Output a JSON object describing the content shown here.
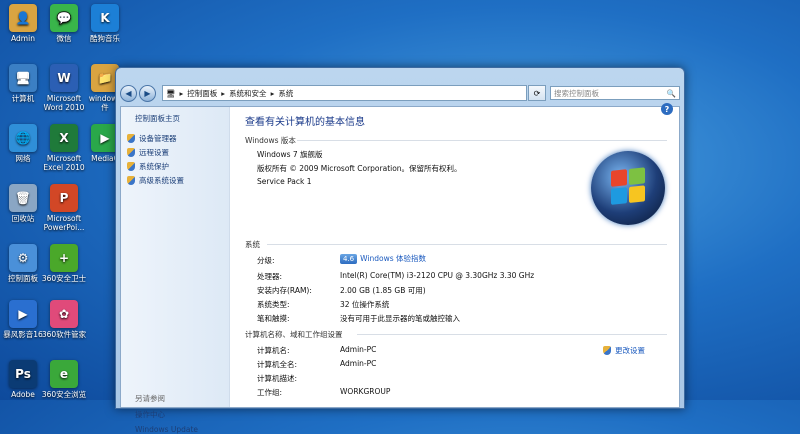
{
  "desktop": {
    "icons": [
      {
        "label": "Admin",
        "glyph": "👤",
        "color": "#d9a441"
      },
      {
        "label": "微信",
        "glyph": "💬",
        "color": "#39b54a"
      },
      {
        "label": "酷狗音乐",
        "glyph": "K",
        "color": "#1c7fd6"
      },
      {
        "label": "计算机",
        "glyph": "🖥",
        "color": "#3b7fc4"
      },
      {
        "label": "Microsoft\nWord 2010",
        "glyph": "W",
        "color": "#2b5fb4"
      },
      {
        "label": "windows\n件",
        "glyph": "📁",
        "color": "#d9a441"
      },
      {
        "label": "网络",
        "glyph": "🌐",
        "color": "#2f8fd8"
      },
      {
        "label": "Microsoft\nExcel 2010",
        "glyph": "X",
        "color": "#1f7a3a"
      },
      {
        "label": "MediaC",
        "glyph": "▶",
        "color": "#2aa84a"
      },
      {
        "label": "回收站",
        "glyph": "🗑",
        "color": "#8aa6c4"
      },
      {
        "label": "Microsoft\nPowerPoi...",
        "glyph": "P",
        "color": "#d24726"
      },
      {
        "label": "控制面板",
        "glyph": "⚙",
        "color": "#4a90d9"
      },
      {
        "label": "360安全卫士",
        "glyph": "+",
        "color": "#4aa82a"
      },
      {
        "label": "暴风影音16",
        "glyph": "▶",
        "color": "#2a6fd0"
      },
      {
        "label": "360软件管家",
        "glyph": "✿",
        "color": "#e04a7a"
      },
      {
        "label": "Adobe",
        "glyph": "Ps",
        "color": "#0b3b74"
      },
      {
        "label": "360安全浏览",
        "glyph": "e",
        "color": "#3aa83a"
      }
    ]
  },
  "window": {
    "breadcrumb": [
      "控制面板",
      "系统和安全",
      "系统"
    ],
    "search_placeholder": "搜索控制面板",
    "sidebar": {
      "home": "控制面板主页",
      "links": [
        "设备管理器",
        "远程设置",
        "系统保护",
        "高级系统设置"
      ],
      "see_also": "另请参阅",
      "see_also_items": [
        "操作中心",
        "Windows Update"
      ]
    },
    "title": "查看有关计算机的基本信息",
    "edition_section": "Windows 版本",
    "edition": "Windows 7 旗舰版",
    "copyright": "版权所有 © 2009 Microsoft Corporation。保留所有权利。",
    "service_pack": "Service Pack 1",
    "system_section": "系统",
    "system_rows": [
      {
        "label": "分级:",
        "value": "Windows 体验指数",
        "badge": "4.6"
      },
      {
        "label": "处理器:",
        "value": "Intel(R) Core(TM) i3-2120 CPU @ 3.30GHz   3.30 GHz"
      },
      {
        "label": "安装内存(RAM):",
        "value": "2.00 GB (1.85 GB 可用)"
      },
      {
        "label": "系统类型:",
        "value": "32 位操作系统"
      },
      {
        "label": "笔和触摸:",
        "value": "没有可用于此显示器的笔或触控输入"
      }
    ],
    "network_section": "计算机名称、域和工作组设置",
    "network_rows": [
      {
        "label": "计算机名:",
        "value": "Admin-PC"
      },
      {
        "label": "计算机全名:",
        "value": "Admin-PC"
      },
      {
        "label": "计算机描述:",
        "value": ""
      },
      {
        "label": "工作组:",
        "value": "WORKGROUP"
      }
    ],
    "change_settings": "更改设置"
  }
}
